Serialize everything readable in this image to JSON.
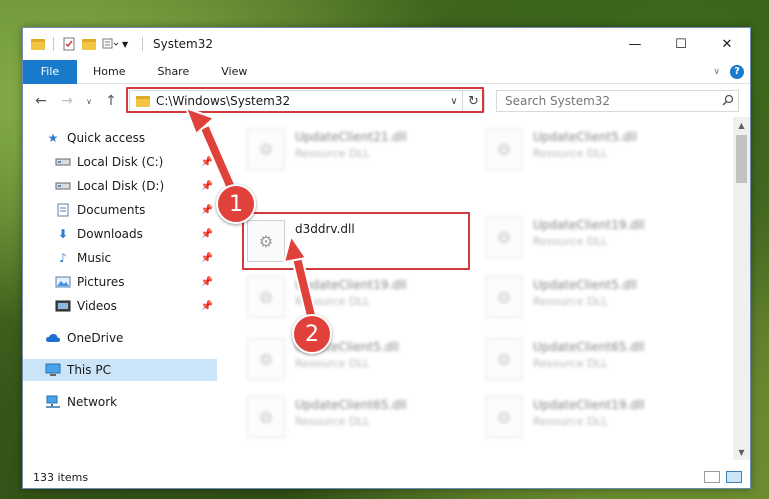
{
  "window": {
    "title": "System32",
    "controls": {
      "minimize": "—",
      "maximize": "☐",
      "close": "✕"
    }
  },
  "ribbon": {
    "file": "File",
    "tabs": [
      "Home",
      "Share",
      "View"
    ]
  },
  "address": {
    "path": "C:\\Windows\\System32"
  },
  "search": {
    "placeholder": "Search System32"
  },
  "nav": {
    "items": [
      {
        "label": "Quick access",
        "icon": "star-icon",
        "pinned": false
      },
      {
        "label": "Local Disk (C:)",
        "icon": "drive-icon",
        "pinned": true
      },
      {
        "label": "Local Disk (D:)",
        "icon": "drive-icon",
        "pinned": true
      },
      {
        "label": "Documents",
        "icon": "documents-icon",
        "pinned": true
      },
      {
        "label": "Downloads",
        "icon": "download-icon",
        "pinned": true
      },
      {
        "label": "Music",
        "icon": "music-icon",
        "pinned": true
      },
      {
        "label": "Pictures",
        "icon": "pictures-icon",
        "pinned": true
      },
      {
        "label": "Videos",
        "icon": "videos-icon",
        "pinned": true
      },
      {
        "label": "OneDrive",
        "icon": "cloud-icon",
        "pinned": false
      },
      {
        "label": "This PC",
        "icon": "computer-icon",
        "pinned": false,
        "selected": true
      },
      {
        "label": "Network",
        "icon": "network-icon",
        "pinned": false
      }
    ]
  },
  "files": {
    "left": [
      {
        "name": "UpdateClient21.dll",
        "type": "Resource DLL",
        "blurred": true
      },
      {
        "name": "d3ddrv.dll",
        "type": "",
        "blurred": false,
        "highlighted": true
      },
      {
        "name": "UpdateClient19.dll",
        "type": "Resource DLL",
        "blurred": true
      },
      {
        "name": "UpdateClient5.dll",
        "type": "Resource DLL",
        "blurred": true
      },
      {
        "name": "UpdateClient65.dll",
        "type": "Resource DLL",
        "blurred": true
      }
    ],
    "right": [
      {
        "name": "UpdateClient5.dll",
        "type": "Resource DLL",
        "blurred": true
      },
      {
        "name": "UpdateClient19.dll",
        "type": "Resource DLL",
        "blurred": true
      },
      {
        "name": "UpdateClient5.dll",
        "type": "Resource DLL",
        "blurred": true
      },
      {
        "name": "UpdateClient65.dll",
        "type": "Resource DLL",
        "blurred": true
      },
      {
        "name": "UpdateClient19.dll",
        "type": "Resource DLL",
        "blurred": true
      }
    ]
  },
  "status": {
    "count": "133 items"
  },
  "annotations": {
    "badge1": "1",
    "badge2": "2",
    "color": "#e0413a"
  }
}
